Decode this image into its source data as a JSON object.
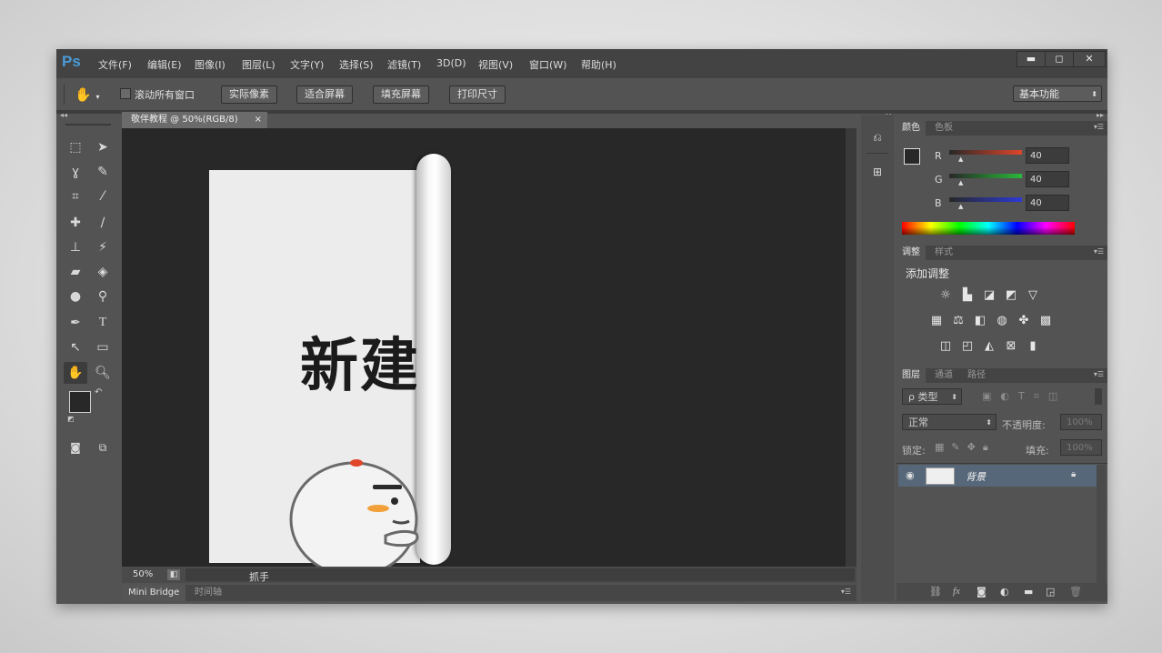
{
  "app": {
    "logo": "Ps"
  },
  "menu": [
    "文件(F)",
    "编辑(E)",
    "图像(I)",
    "图层(L)",
    "文字(Y)",
    "选择(S)",
    "滤镜(T)",
    "3D(D)",
    "视图(V)",
    "窗口(W)",
    "帮助(H)"
  ],
  "window_controls": {
    "minimize": "▬",
    "maximize": "◻",
    "close": "✕"
  },
  "options_bar": {
    "scroll_all_label": "滚动所有窗口",
    "buttons": [
      "实际像素",
      "适合屏幕",
      "填充屏幕",
      "打印尺寸"
    ],
    "workspace": "基本功能"
  },
  "document": {
    "tab_title": "敬伴教程 @ 50%(RGB/8)",
    "tab_close": "×",
    "canvas_text": "新建",
    "zoom": "50%",
    "status_tool": "抓手"
  },
  "bottom_tabs": [
    "Mini Bridge",
    "时间轴"
  ],
  "color_panel": {
    "tabs": [
      "颜色",
      "色板"
    ],
    "channels": [
      {
        "name": "R",
        "value": "40",
        "color": "#e0452a"
      },
      {
        "name": "G",
        "value": "40",
        "color": "#29b83a"
      },
      {
        "name": "B",
        "value": "40",
        "color": "#2c3ad6"
      }
    ],
    "foreground": "#282828",
    "background": "#f2f2f2"
  },
  "adjustments_panel": {
    "tabs": [
      "调整",
      "样式"
    ],
    "title": "添加调整"
  },
  "layers_panel": {
    "tabs": [
      "图层",
      "通道",
      "路径"
    ],
    "filter_label": "ρ 类型",
    "blend_mode": "正常",
    "opacity_label": "不透明度:",
    "opacity_value": "100%",
    "lock_label": "锁定:",
    "fill_label": "填充:",
    "fill_value": "100%",
    "layers": [
      {
        "name": "背景"
      }
    ]
  }
}
